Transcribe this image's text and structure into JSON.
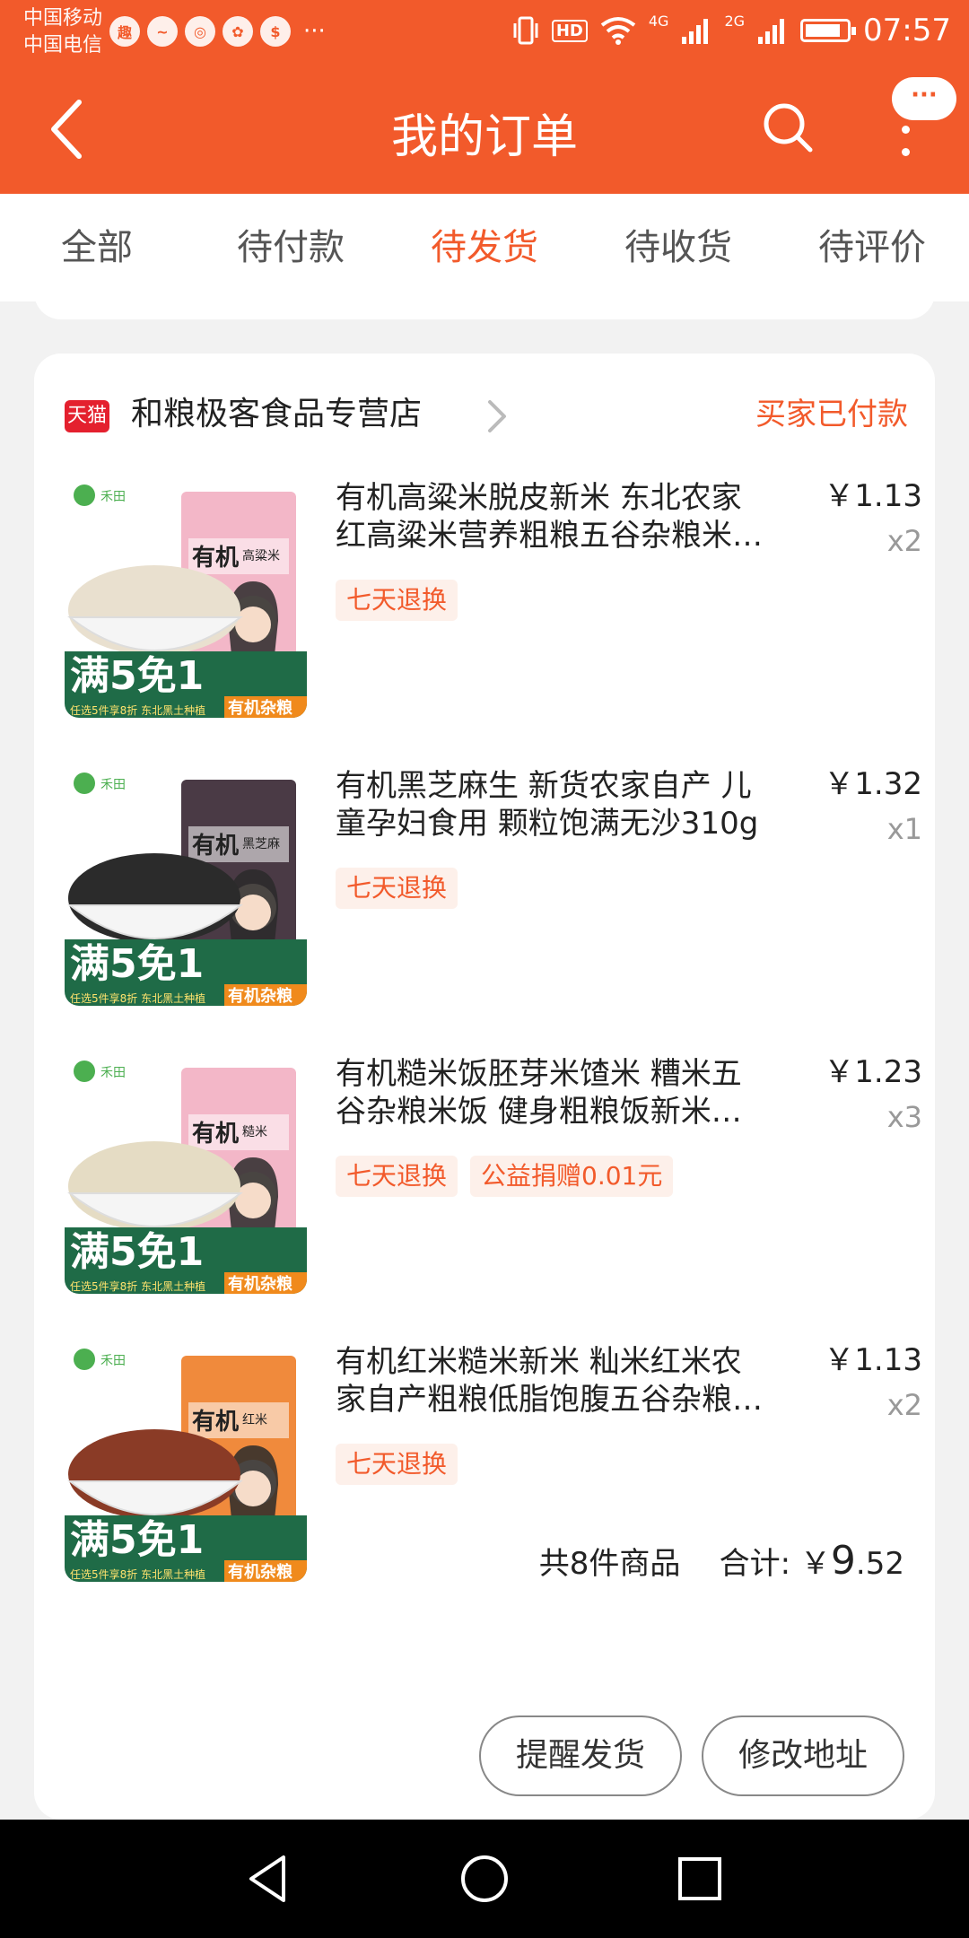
{
  "status_bar": {
    "carrier_1": "中国移动",
    "carrier_2": "中国电信",
    "hd": "HD",
    "net_1": "4G",
    "net_2": "2G",
    "time": "07:57"
  },
  "header": {
    "title": "我的订单",
    "more_bubble": "···"
  },
  "tabs": [
    {
      "label": "全部",
      "active": false
    },
    {
      "label": "待付款",
      "active": false
    },
    {
      "label": "待发货",
      "active": true
    },
    {
      "label": "待收货",
      "active": false
    },
    {
      "label": "待评价",
      "active": false
    }
  ],
  "order": {
    "platform_badge": "天猫",
    "shop_name": "和粮极客食品专营店",
    "status": "买家已付款",
    "items": [
      {
        "name": "有机高粱米脱皮新米 东北农家红高粱米营养粗粮五谷杂粮米…",
        "price": "￥1.13",
        "qty": "x2",
        "tags": [
          "七天退换"
        ],
        "thumb": {
          "brand": "禾田",
          "label": "有机",
          "kind": "高粱米",
          "promo": "满5免1",
          "sub": "任选5件享8折 东北黑土种植",
          "corner": "有机杂粮",
          "box_color": "#f3b7c8",
          "grain_color": "#e9e0cf"
        }
      },
      {
        "name": "有机黑芝麻生 新货农家自产 儿童孕妇食用 颗粒饱满无沙310g",
        "price": "￥1.32",
        "qty": "x1",
        "tags": [
          "七天退换"
        ],
        "thumb": {
          "brand": "禾田",
          "label": "有机",
          "kind": "黑芝麻",
          "promo": "满5免1",
          "sub": "任选5件享8折 东北黑土种植",
          "corner": "有机杂粮",
          "box_color": "#4a3a45",
          "grain_color": "#2b2b2b"
        }
      },
      {
        "name": "有机糙米饭胚芽米馇米 糟米五谷杂粮米饭 健身粗粮饭新米…",
        "price": "￥1.23",
        "qty": "x3",
        "tags": [
          "七天退换",
          "公益捐赠0.01元"
        ],
        "thumb": {
          "brand": "禾田",
          "label": "有机",
          "kind": "糙米",
          "promo": "满5免1",
          "sub": "任选5件享8折 东北黑土种植",
          "corner": "有机杂粮",
          "box_color": "#f3b7c8",
          "grain_color": "#e5dcc4"
        }
      },
      {
        "name": "有机红米糙米新米 籼米红米农家自产粗粮低脂饱腹五谷杂粮…",
        "price": "￥1.13",
        "qty": "x2",
        "tags": [
          "七天退换"
        ],
        "thumb": {
          "brand": "禾田",
          "label": "有机",
          "kind": "红米",
          "promo": "满5免1",
          "sub": "任选5件享8折 东北黑土种植",
          "corner": "有机杂粮",
          "box_color": "#f08a3c",
          "grain_color": "#8a3b26"
        }
      }
    ],
    "summary_count": "共8件商品",
    "summary_total_label": "合计: ￥",
    "summary_total_int": "9",
    "summary_total_dec": ".52",
    "buttons": [
      "提醒发货",
      "修改地址"
    ]
  }
}
